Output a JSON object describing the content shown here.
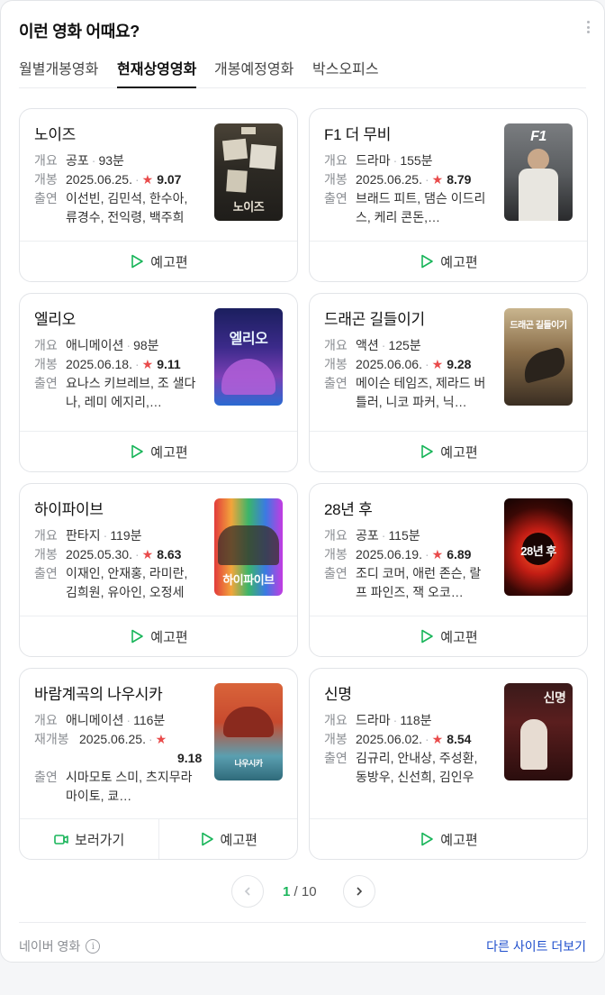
{
  "header": {
    "title": "이런 영화 어때요?"
  },
  "tabs": [
    {
      "label": "월별개봉영화"
    },
    {
      "label": "현재상영영화"
    },
    {
      "label": "개봉예정영화"
    },
    {
      "label": "박스오피스"
    }
  ],
  "labels": {
    "genre": "개요",
    "release": "개봉",
    "rerelease": "재개봉",
    "cast": "출연",
    "trailer": "예고편",
    "watch": "보러가기"
  },
  "movies": [
    {
      "title": "노이즈",
      "genre": "공포",
      "runtime": "93분",
      "date": "2025.06.25.",
      "rating": "9.07",
      "cast": "이선빈, 김민석, 한수아, 류경수, 전익령, 백주희",
      "poster_text": "노이즈"
    },
    {
      "title": "F1 더 무비",
      "genre": "드라마",
      "runtime": "155분",
      "date": "2025.06.25.",
      "rating": "8.79",
      "cast": "브래드 피트, 댐슨 이드리스, 케리 콘돈,…",
      "poster_text": "F1"
    },
    {
      "title": "엘리오",
      "genre": "애니메이션",
      "runtime": "98분",
      "date": "2025.06.18.",
      "rating": "9.11",
      "cast": "요나스 키브레브, 조 샐다나, 레미 에지리,…",
      "poster_text": "엘리오"
    },
    {
      "title": "드래곤 길들이기",
      "genre": "액션",
      "runtime": "125분",
      "date": "2025.06.06.",
      "rating": "9.28",
      "cast": "메이슨 테임즈, 제라드 버틀러, 니코 파커, 닉…",
      "poster_text": "드래곤 길들이기"
    },
    {
      "title": "하이파이브",
      "genre": "판타지",
      "runtime": "119분",
      "date": "2025.05.30.",
      "rating": "8.63",
      "cast": "이재인, 안재홍, 라미란, 김희원, 유아인, 오정세",
      "poster_text": "하이파이브"
    },
    {
      "title": "28년 후",
      "genre": "공포",
      "runtime": "115분",
      "date": "2025.06.19.",
      "rating": "6.89",
      "cast": "조디 코머, 애런 존슨, 랄프 파인즈, 잭 오코…",
      "poster_text": "28년 후"
    },
    {
      "title": "바람계곡의 나우시카",
      "genre": "애니메이션",
      "runtime": "116분",
      "date": "2025.06.25.",
      "rating": "9.18",
      "cast": "시마모토 스미, 츠지무라 마이토, 쿄…",
      "poster_text": "나우시카"
    },
    {
      "title": "신명",
      "genre": "드라마",
      "runtime": "118분",
      "date": "2025.06.02.",
      "rating": "8.54",
      "cast": "김규리, 안내상, 주성환, 동방우, 신선희, 김인우",
      "poster_text": "신명"
    }
  ],
  "pager": {
    "current": "1",
    "separator": "/",
    "total": "10"
  },
  "footer": {
    "source": "네이버 영화",
    "more_link": "다른 사이트 더보기"
  },
  "colors": {
    "accent": "#19b55a",
    "star": "#e94b4b",
    "link": "#1f4fcc"
  }
}
